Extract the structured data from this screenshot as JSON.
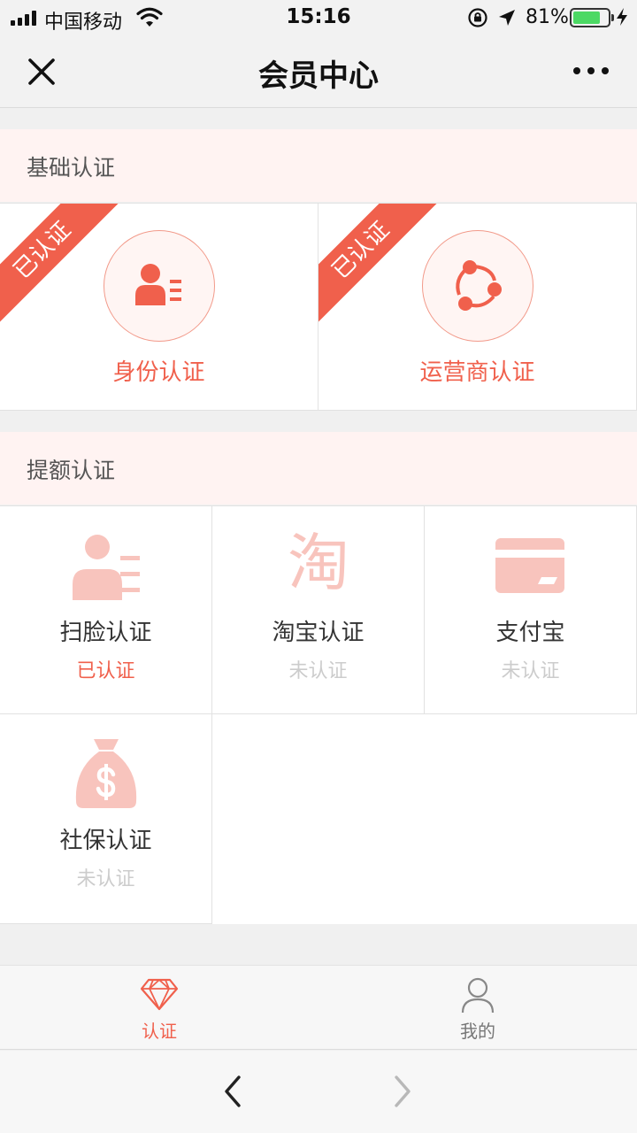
{
  "status_bar": {
    "carrier": "中国移动",
    "time": "15:16",
    "battery_percent": "81%"
  },
  "nav": {
    "title": "会员中心"
  },
  "basic_section": {
    "title": "基础认证",
    "items": [
      {
        "label": "身份认证",
        "ribbon": "已认证",
        "icon": "id-card-icon"
      },
      {
        "label": "运营商认证",
        "ribbon": "已认证",
        "icon": "share-nodes-icon"
      }
    ]
  },
  "limit_section": {
    "title": "提额认证",
    "items": [
      {
        "label": "扫脸认证",
        "status": "已认证",
        "icon": "id-card-icon"
      },
      {
        "label": "淘宝认证",
        "status": "未认证",
        "icon": "taobao-icon"
      },
      {
        "label": "支付宝",
        "status": "未认证",
        "icon": "card-icon"
      },
      {
        "label": "社保认证",
        "status": "未认证",
        "icon": "money-bag-icon"
      }
    ]
  },
  "taobao_glyph": "淘",
  "tab_bar": {
    "tabs": [
      {
        "label": "认证",
        "active": true
      },
      {
        "label": "我的",
        "active": false
      }
    ]
  },
  "colors": {
    "accent": "#f0604c",
    "pale_icon": "#f8c4bd",
    "inactive_text": "#cccccc",
    "section_bg": "#fff3f2"
  }
}
